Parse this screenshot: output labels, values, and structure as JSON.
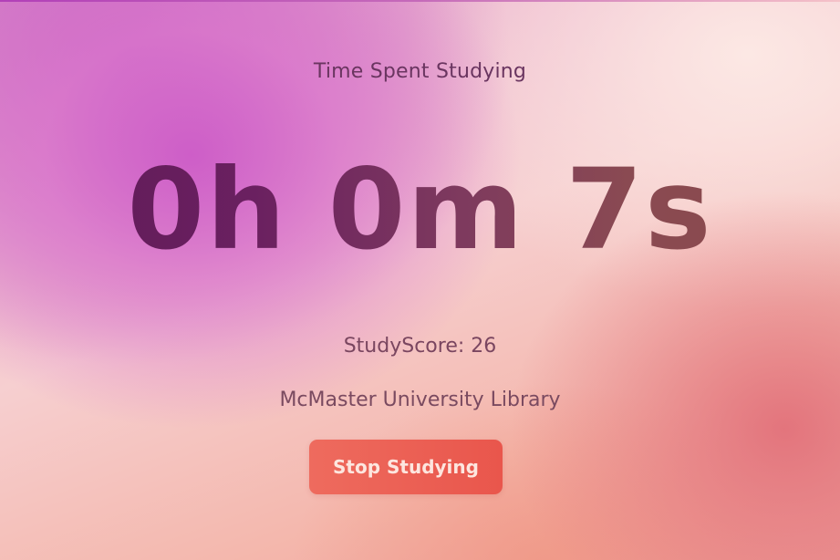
{
  "heading": "Time Spent Studying",
  "timer": {
    "display": "0h 0m 7s",
    "hours": 0,
    "minutes": 0,
    "seconds": 7
  },
  "score": {
    "label": "StudyScore: 26",
    "value": 26
  },
  "location": "McMaster University Library",
  "actions": {
    "stop_label": "Stop Studying"
  },
  "colors": {
    "accent": "#e9564c",
    "text": "#6a3560",
    "timer": "#6a2858"
  }
}
